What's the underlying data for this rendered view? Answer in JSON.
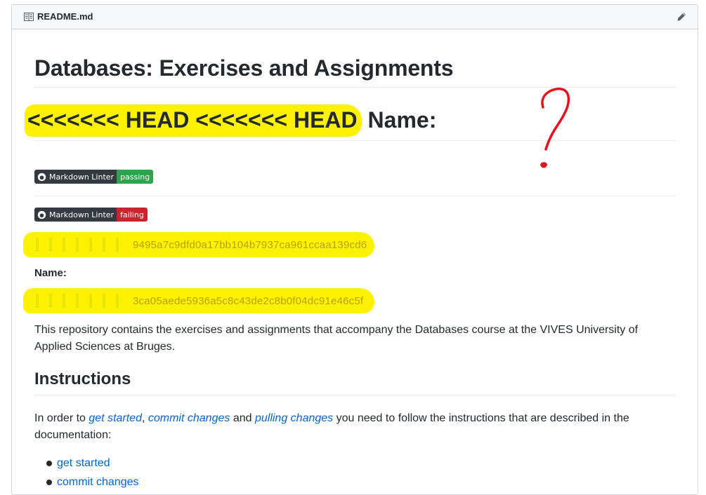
{
  "file": {
    "name": "README.md"
  },
  "readme": {
    "title": "Databases: Exercises and Assignments",
    "conflict_heading": {
      "marker": "<<<<<<< HEAD <<<<<<< HEAD",
      "rest": "Name:"
    },
    "badges": [
      {
        "label": "Markdown Linter",
        "status": "passing",
        "color": "#2ea44f"
      },
      {
        "label": "Markdown Linter",
        "status": "failing",
        "color": "#cb2431"
      }
    ],
    "hash1": "9495a7c9dfd0a17bb104b7937ca961ccaa139cd6",
    "name_label": "Name:",
    "hash2": "3ca05aede5936a5c8c43de2c8b0f04dc91e46c5f",
    "description": "This repository contains the exercises and assignments that accompany the Databases course at the VIVES University of Applied Sciences at Bruges.",
    "instructions": {
      "heading": "Instructions",
      "intro_1": "In order to ",
      "link_1": "get started",
      "sep_1": ", ",
      "link_2": "commit changes",
      "sep_2": " and ",
      "link_3": "pulling changes",
      "intro_2": " you need to follow the instructions that are described in the documentation:",
      "list": [
        "get started",
        "commit changes"
      ]
    }
  },
  "annotation_color": "#e8101b",
  "highlight_color": "#fff200"
}
